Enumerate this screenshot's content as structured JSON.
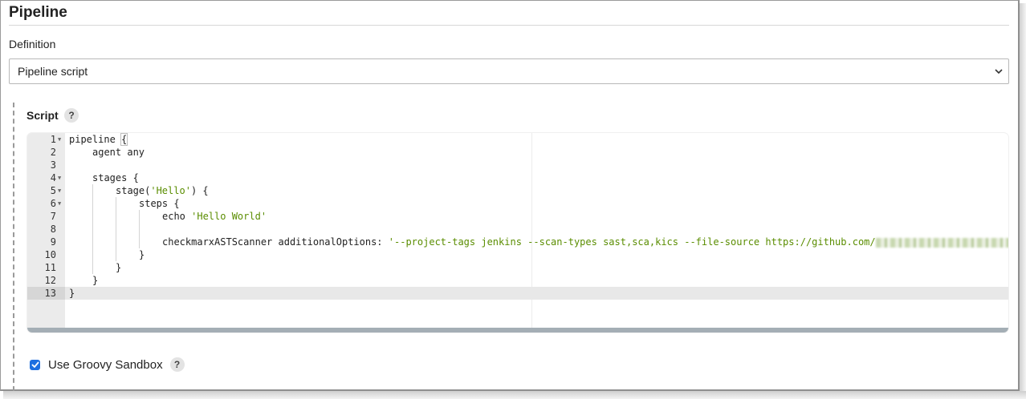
{
  "section": {
    "title": "Pipeline"
  },
  "definition": {
    "label": "Definition",
    "selected": "Pipeline script"
  },
  "script": {
    "label": "Script",
    "help": "?",
    "lines": [
      {
        "num": "1",
        "fold": true,
        "indent": 0,
        "parts": [
          {
            "t": "pipeline "
          },
          {
            "t": "{",
            "bracket": true
          }
        ]
      },
      {
        "num": "2",
        "fold": false,
        "indent": 1,
        "parts": [
          {
            "t": "agent any"
          }
        ]
      },
      {
        "num": "3",
        "fold": false,
        "indent": 0,
        "parts": []
      },
      {
        "num": "4",
        "fold": true,
        "indent": 1,
        "parts": [
          {
            "t": "stages {"
          }
        ]
      },
      {
        "num": "5",
        "fold": true,
        "indent": 2,
        "parts": [
          {
            "t": "stage("
          },
          {
            "t": "'Hello'",
            "s": true
          },
          {
            "t": ") {"
          }
        ]
      },
      {
        "num": "6",
        "fold": true,
        "indent": 3,
        "parts": [
          {
            "t": "steps {"
          }
        ]
      },
      {
        "num": "7",
        "fold": false,
        "indent": 4,
        "parts": [
          {
            "t": "echo "
          },
          {
            "t": "'Hello World'",
            "s": true
          }
        ]
      },
      {
        "num": "8",
        "fold": false,
        "indent": 4,
        "parts": []
      },
      {
        "num": "9",
        "fold": false,
        "indent": 4,
        "parts": [
          {
            "t": "checkmarxASTScanner additionalOptions: "
          },
          {
            "t": "'--project-tags jenkins --scan-types sast,sca,kics --file-source https://github.com/",
            "s": true
          },
          {
            "blur": true
          }
        ]
      },
      {
        "num": "10",
        "fold": false,
        "indent": 3,
        "parts": [
          {
            "t": "}"
          }
        ]
      },
      {
        "num": "11",
        "fold": false,
        "indent": 2,
        "parts": [
          {
            "t": "}"
          }
        ]
      },
      {
        "num": "12",
        "fold": false,
        "indent": 1,
        "parts": [
          {
            "t": "}"
          }
        ]
      },
      {
        "num": "13",
        "fold": false,
        "indent": 0,
        "parts": [
          {
            "t": "}"
          }
        ]
      }
    ]
  },
  "sandbox": {
    "label": "Use Groovy Sandbox",
    "checked": true,
    "help": "?"
  },
  "colors": {
    "string": "#5a8d00",
    "checkbox": "#1d6fe0",
    "gutter": "#ebebeb"
  }
}
